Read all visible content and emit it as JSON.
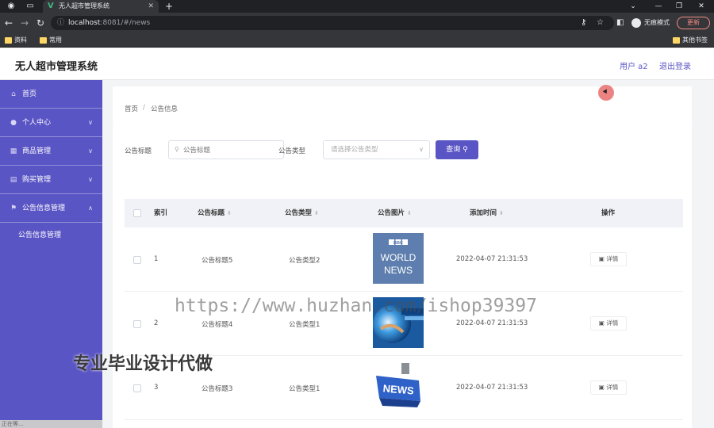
{
  "browser": {
    "tab_title": "无人超市管理系统",
    "new_tab": "+",
    "url_host": "localhost",
    "url_path": ":8081/#/news",
    "incognito_label": "无痕模式",
    "update_label": "更新",
    "bookmarks": [
      {
        "label": "资料"
      },
      {
        "label": "常用"
      }
    ],
    "other_bookmarks": "其他书签"
  },
  "header": {
    "app_title": "无人超市管理系统",
    "user_label": "用户 a2",
    "logout_label": "退出登录"
  },
  "sidebar": {
    "items": [
      {
        "label": "首页",
        "icon": "home-icon"
      },
      {
        "label": "个人中心",
        "icon": "user-icon"
      },
      {
        "label": "商品管理",
        "icon": "goods-icon"
      },
      {
        "label": "购买管理",
        "icon": "purchase-icon"
      },
      {
        "label": "公告信息管理",
        "icon": "announcement-icon"
      }
    ],
    "subitems": [
      {
        "label": "公告信息管理"
      }
    ]
  },
  "breadcrumb": {
    "home": "首页",
    "separator": "/",
    "current": "公告信息"
  },
  "search": {
    "title_label": "公告标题",
    "title_placeholder": "公告标题",
    "type_label": "公告类型",
    "type_placeholder": "请选择公告类型",
    "query_label": "查询"
  },
  "table": {
    "headers": {
      "index": "索引",
      "title": "公告标题",
      "type": "公告类型",
      "image": "公告图片",
      "time": "添加时间",
      "action": "操作"
    },
    "sort_glyph": "⬍",
    "rows": [
      {
        "index": "1",
        "title": "公告标题5",
        "type": "公告类型2",
        "image": "bbc-world-news-image",
        "image_text": [
          "BBC",
          "WORLD",
          "NEWS"
        ],
        "time": "2022-04-07 21:31:53",
        "action": "详情"
      },
      {
        "index": "2",
        "title": "公告标题4",
        "type": "公告类型1",
        "image": "globe-news-image",
        "image_text": [],
        "time": "2022-04-07 21:31:53",
        "action": "详情"
      },
      {
        "index": "3",
        "title": "公告标题3",
        "type": "公告类型1",
        "image": "news-key-image",
        "image_text": [
          "NEWS"
        ],
        "time": "2022-04-07 21:31:53",
        "action": "详情"
      }
    ]
  },
  "overlay": {
    "watermark": "https://www.huzhan.com/ishop39397",
    "promo": "专业毕业设计代做",
    "status_text": "正在等..."
  },
  "colors": {
    "sidebar_bg": "#5a55c4",
    "accent": "#5a55c4",
    "browser_dark": "#202124"
  }
}
